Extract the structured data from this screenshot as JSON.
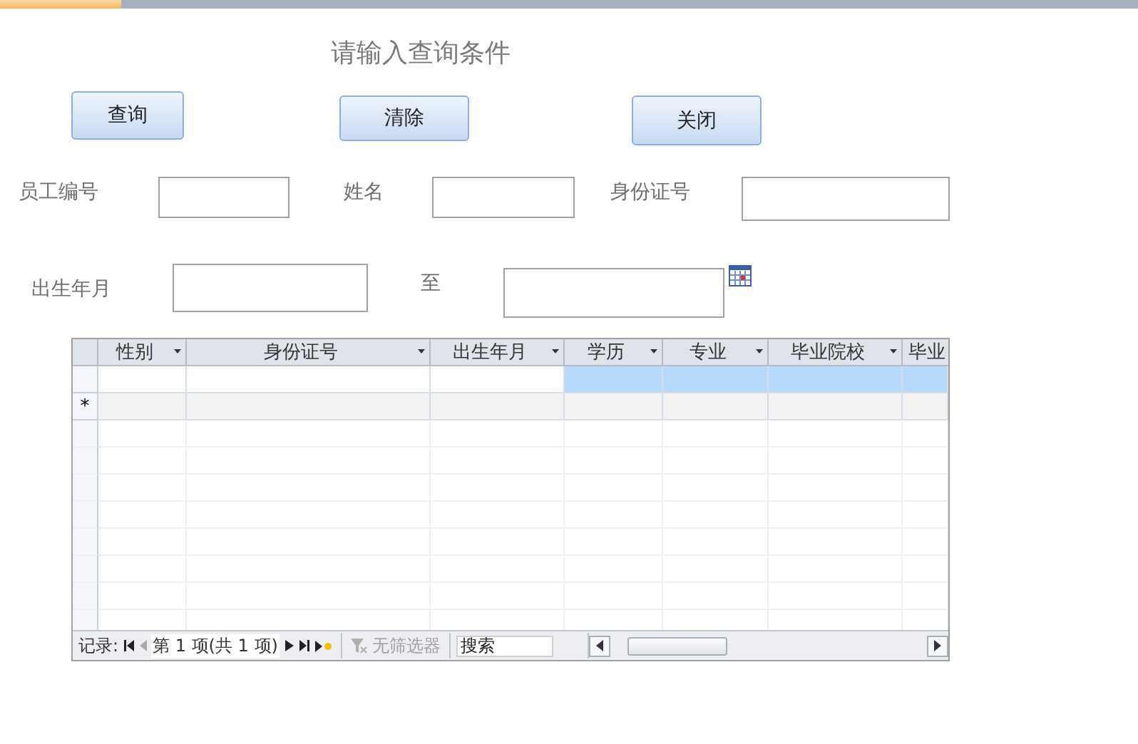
{
  "title": "请输入查询条件",
  "buttons": [
    {
      "label": "查询"
    },
    {
      "label": "清除"
    },
    {
      "label": "关闭"
    }
  ],
  "fields_row1": [
    {
      "label": "员工编号"
    },
    {
      "label": "姓名"
    },
    {
      "label": "身份证号"
    }
  ],
  "fields_row2": [
    {
      "label": "出生年月"
    },
    {
      "label": "至"
    }
  ],
  "table": {
    "columns": [
      {
        "label": "性别"
      },
      {
        "label": "身份证号"
      },
      {
        "label": "出生年月"
      },
      {
        "label": "学历"
      },
      {
        "label": "专业"
      },
      {
        "label": "毕业院校"
      },
      {
        "label": "毕业"
      }
    ],
    "rows": [
      {
        "kind": "record",
        "cells": [
          {
            "selected": false
          },
          {
            "selected": false
          },
          {
            "selected": false
          },
          {
            "selected": true
          },
          {
            "selected": true
          },
          {
            "selected": true
          },
          {
            "selected": true
          }
        ]
      },
      {
        "kind": "new",
        "marker": "*"
      }
    ]
  },
  "navigator": {
    "label": "记录:",
    "position": "第 1 项(共 1 项)",
    "filter": {
      "label": "无筛选器",
      "disabled": true
    },
    "search": {
      "placeholder": "搜索"
    }
  }
}
